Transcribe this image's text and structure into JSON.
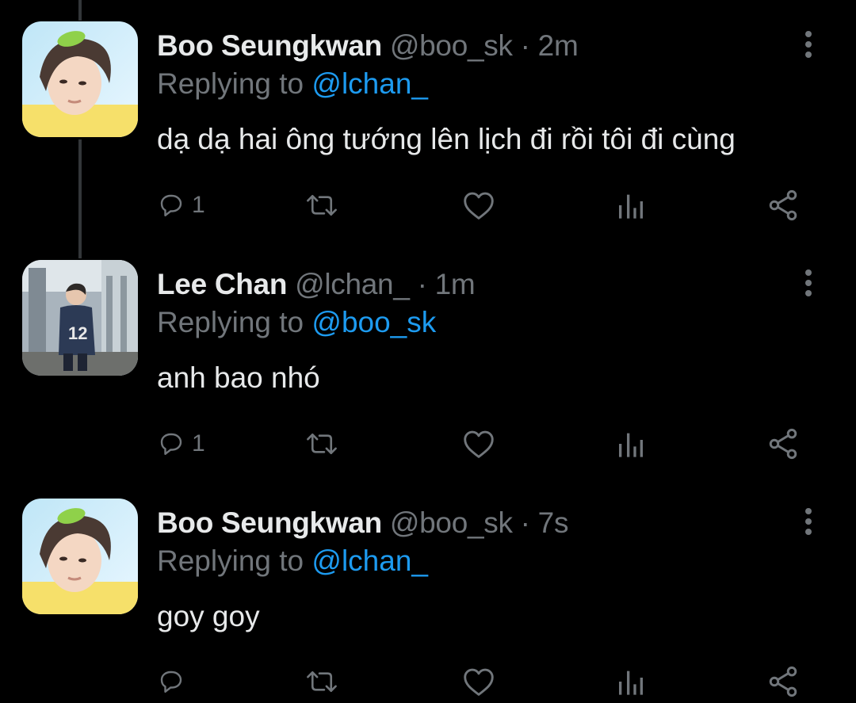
{
  "tweets": [
    {
      "display_name": "Boo Seungkwan",
      "handle": "@boo_sk",
      "separator": "·",
      "time": "2m",
      "replying_prefix": "Replying to",
      "replying_handle": "@lchan_",
      "text": "dạ dạ hai ông tướng lên lịch đi rồi tôi đi cùng",
      "reply_count": "1",
      "avatar": "avatar-boo"
    },
    {
      "display_name": "Lee Chan",
      "handle": "@lchan_",
      "separator": "·",
      "time": "1m",
      "replying_prefix": "Replying to",
      "replying_handle": "@boo_sk",
      "text": "anh bao nhó",
      "reply_count": "1",
      "avatar": "avatar-lee"
    },
    {
      "display_name": "Boo Seungkwan",
      "handle": "@boo_sk",
      "separator": "·",
      "time": "7s",
      "replying_prefix": "Replying to",
      "replying_handle": "@lchan_",
      "text": "goy goy",
      "reply_count": "",
      "avatar": "avatar-boo"
    }
  ],
  "icons": {
    "reply": "reply-icon",
    "retweet": "retweet-icon",
    "like": "heart-icon",
    "views": "views-icon",
    "share": "share-icon",
    "more": "more-icon"
  },
  "colors": {
    "background": "#000000",
    "primary_text": "#e7e9ea",
    "secondary_text": "#71767b",
    "mention": "#1d9bf0",
    "thread_line": "#333639"
  }
}
